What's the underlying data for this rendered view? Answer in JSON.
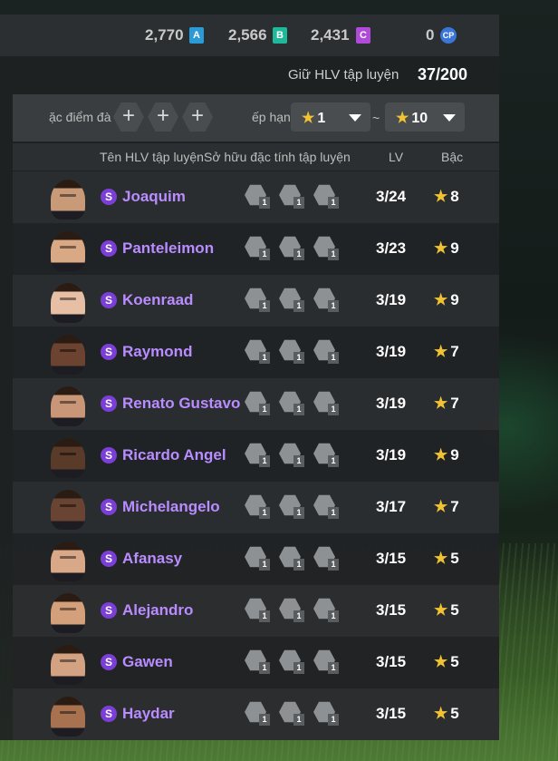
{
  "currency": {
    "a_amount": "2,770",
    "a_badge": "A",
    "a_color": "#2b9bd8",
    "b_amount": "2,566",
    "b_badge": "B",
    "b_color": "#1fb89a",
    "c_amount": "2,431",
    "c_badge": "C",
    "c_color": "#b04ad8",
    "cp_amount": "0",
    "cp_badge": "CP"
  },
  "header": {
    "hold_label": "Giữ HLV tập luyện",
    "hold_value": "37/200"
  },
  "filters": {
    "trait_label": "ặc điểm đà",
    "add_symbol": "+",
    "rank_label": "ếp hạng",
    "min_rank": "1",
    "tilde": "~",
    "max_rank": "10"
  },
  "columns": {
    "name": "Tên HLV tập luyện",
    "traits": "Sở hữu đặc tính tập luyện",
    "lv": "LV",
    "grade": "Bậc"
  },
  "coaches": [
    {
      "tier": "S",
      "name": "Joaquim",
      "lv": "3/24",
      "grade": "8",
      "trait_levels": [
        "1",
        "1",
        "1"
      ],
      "skin": "#c89a78"
    },
    {
      "tier": "S",
      "name": "Panteleimon",
      "lv": "3/23",
      "grade": "9",
      "trait_levels": [
        "1",
        "1",
        "1"
      ],
      "skin": "#d9a884"
    },
    {
      "tier": "S",
      "name": "Koenraad",
      "lv": "3/19",
      "grade": "9",
      "trait_levels": [
        "1",
        "1",
        "1"
      ],
      "skin": "#e6bfa4"
    },
    {
      "tier": "S",
      "name": "Raymond",
      "lv": "3/19",
      "grade": "7",
      "trait_levels": [
        "1",
        "1",
        "1"
      ],
      "skin": "#6b4330"
    },
    {
      "tier": "S",
      "name": "Renato Gustavo",
      "lv": "3/19",
      "grade": "7",
      "trait_levels": [
        "1",
        "1",
        "1"
      ],
      "skin": "#c99778"
    },
    {
      "tier": "S",
      "name": "Ricardo Angel",
      "lv": "3/19",
      "grade": "9",
      "trait_levels": [
        "1",
        "1",
        "1"
      ],
      "skin": "#5a3a28"
    },
    {
      "tier": "S",
      "name": "Michelangelo",
      "lv": "3/17",
      "grade": "7",
      "trait_levels": [
        "1",
        "1",
        "1"
      ],
      "skin": "#6a4432"
    },
    {
      "tier": "S",
      "name": "Afanasy",
      "lv": "3/15",
      "grade": "5",
      "trait_levels": [
        "1",
        "1",
        "1"
      ],
      "skin": "#d8a888"
    },
    {
      "tier": "S",
      "name": "Alejandro",
      "lv": "3/15",
      "grade": "5",
      "trait_levels": [
        "1",
        "1",
        "1"
      ],
      "skin": "#d4a07c"
    },
    {
      "tier": "S",
      "name": "Gawen",
      "lv": "3/15",
      "grade": "5",
      "trait_levels": [
        "1",
        "1",
        "1"
      ],
      "skin": "#d2a282"
    },
    {
      "tier": "S",
      "name": "Haydar",
      "lv": "3/15",
      "grade": "5",
      "trait_levels": [
        "1",
        "1",
        "1"
      ],
      "skin": "#a87250"
    }
  ]
}
